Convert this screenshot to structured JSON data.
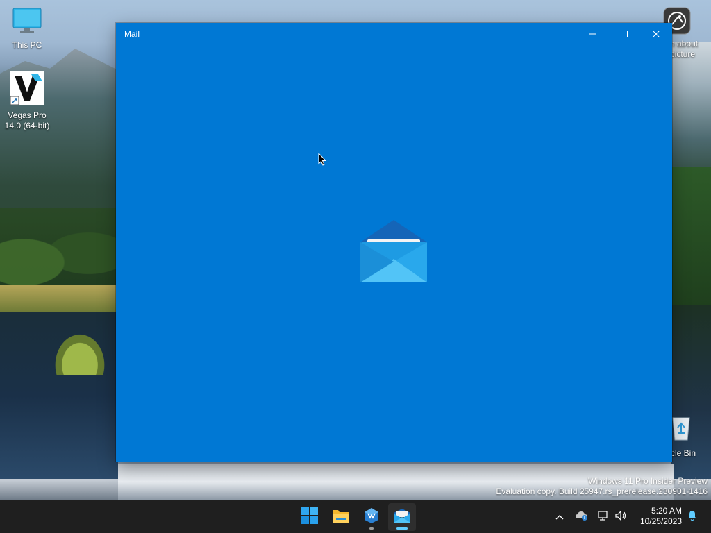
{
  "desktop": {
    "icons": [
      {
        "label": "This PC",
        "icon": "monitor-icon"
      },
      {
        "label": "Vegas Pro 14.0 (64-bit)",
        "icon": "vegas-pro-icon"
      },
      {
        "label": "n about picture",
        "icon": "learn-about-picture-icon"
      },
      {
        "label": "rcle Bin",
        "icon": "recycle-bin-icon"
      }
    ],
    "watermark": {
      "line1": "Windows 11 Pro Insider Preview",
      "line2": "Evaluation copy. Build 25947.rs_prerelease.230901-1416"
    }
  },
  "window": {
    "title": "Mail",
    "background": "#0078d4",
    "controls": [
      "minimize-icon",
      "maximize-icon",
      "close-icon"
    ],
    "splash_icon": "mail-envelope-icon"
  },
  "taskbar": {
    "apps": [
      {
        "name": "Start",
        "icon": "windows-start-icon"
      },
      {
        "name": "File Explorer",
        "icon": "folder-icon"
      },
      {
        "name": "App",
        "icon": "app-icon"
      },
      {
        "name": "Mail",
        "icon": "mail-icon"
      }
    ],
    "tray_icons": [
      "chevron-up-icon",
      "onedrive-icon",
      "network-icon",
      "volume-icon",
      "notification-bell-icon"
    ],
    "clock": {
      "time": "5:20 AM",
      "date": "10/25/2023"
    },
    "accent": "#60cdff"
  }
}
